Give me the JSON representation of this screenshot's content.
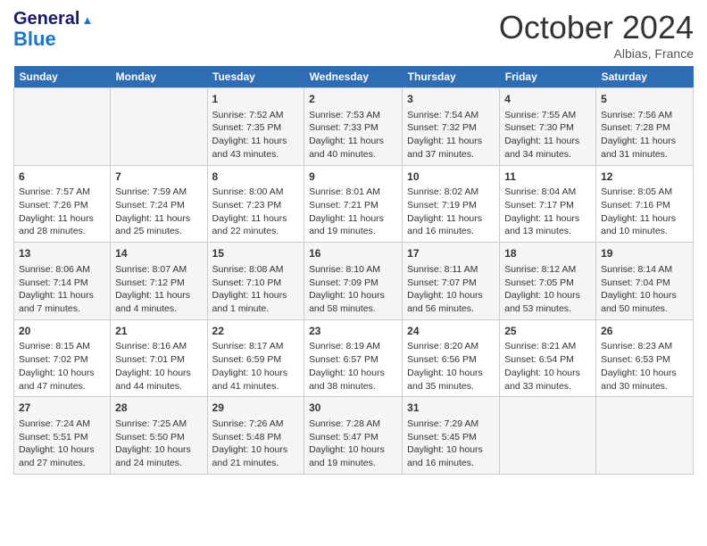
{
  "header": {
    "logo_line1": "General",
    "logo_line2": "Blue",
    "month": "October 2024",
    "location": "Albias, France"
  },
  "days_of_week": [
    "Sunday",
    "Monday",
    "Tuesday",
    "Wednesday",
    "Thursday",
    "Friday",
    "Saturday"
  ],
  "weeks": [
    [
      {
        "day": "",
        "sunrise": "",
        "sunset": "",
        "daylight": ""
      },
      {
        "day": "",
        "sunrise": "",
        "sunset": "",
        "daylight": ""
      },
      {
        "day": "1",
        "sunrise": "Sunrise: 7:52 AM",
        "sunset": "Sunset: 7:35 PM",
        "daylight": "Daylight: 11 hours and 43 minutes."
      },
      {
        "day": "2",
        "sunrise": "Sunrise: 7:53 AM",
        "sunset": "Sunset: 7:33 PM",
        "daylight": "Daylight: 11 hours and 40 minutes."
      },
      {
        "day": "3",
        "sunrise": "Sunrise: 7:54 AM",
        "sunset": "Sunset: 7:32 PM",
        "daylight": "Daylight: 11 hours and 37 minutes."
      },
      {
        "day": "4",
        "sunrise": "Sunrise: 7:55 AM",
        "sunset": "Sunset: 7:30 PM",
        "daylight": "Daylight: 11 hours and 34 minutes."
      },
      {
        "day": "5",
        "sunrise": "Sunrise: 7:56 AM",
        "sunset": "Sunset: 7:28 PM",
        "daylight": "Daylight: 11 hours and 31 minutes."
      }
    ],
    [
      {
        "day": "6",
        "sunrise": "Sunrise: 7:57 AM",
        "sunset": "Sunset: 7:26 PM",
        "daylight": "Daylight: 11 hours and 28 minutes."
      },
      {
        "day": "7",
        "sunrise": "Sunrise: 7:59 AM",
        "sunset": "Sunset: 7:24 PM",
        "daylight": "Daylight: 11 hours and 25 minutes."
      },
      {
        "day": "8",
        "sunrise": "Sunrise: 8:00 AM",
        "sunset": "Sunset: 7:23 PM",
        "daylight": "Daylight: 11 hours and 22 minutes."
      },
      {
        "day": "9",
        "sunrise": "Sunrise: 8:01 AM",
        "sunset": "Sunset: 7:21 PM",
        "daylight": "Daylight: 11 hours and 19 minutes."
      },
      {
        "day": "10",
        "sunrise": "Sunrise: 8:02 AM",
        "sunset": "Sunset: 7:19 PM",
        "daylight": "Daylight: 11 hours and 16 minutes."
      },
      {
        "day": "11",
        "sunrise": "Sunrise: 8:04 AM",
        "sunset": "Sunset: 7:17 PM",
        "daylight": "Daylight: 11 hours and 13 minutes."
      },
      {
        "day": "12",
        "sunrise": "Sunrise: 8:05 AM",
        "sunset": "Sunset: 7:16 PM",
        "daylight": "Daylight: 11 hours and 10 minutes."
      }
    ],
    [
      {
        "day": "13",
        "sunrise": "Sunrise: 8:06 AM",
        "sunset": "Sunset: 7:14 PM",
        "daylight": "Daylight: 11 hours and 7 minutes."
      },
      {
        "day": "14",
        "sunrise": "Sunrise: 8:07 AM",
        "sunset": "Sunset: 7:12 PM",
        "daylight": "Daylight: 11 hours and 4 minutes."
      },
      {
        "day": "15",
        "sunrise": "Sunrise: 8:08 AM",
        "sunset": "Sunset: 7:10 PM",
        "daylight": "Daylight: 11 hours and 1 minute."
      },
      {
        "day": "16",
        "sunrise": "Sunrise: 8:10 AM",
        "sunset": "Sunset: 7:09 PM",
        "daylight": "Daylight: 10 hours and 58 minutes."
      },
      {
        "day": "17",
        "sunrise": "Sunrise: 8:11 AM",
        "sunset": "Sunset: 7:07 PM",
        "daylight": "Daylight: 10 hours and 56 minutes."
      },
      {
        "day": "18",
        "sunrise": "Sunrise: 8:12 AM",
        "sunset": "Sunset: 7:05 PM",
        "daylight": "Daylight: 10 hours and 53 minutes."
      },
      {
        "day": "19",
        "sunrise": "Sunrise: 8:14 AM",
        "sunset": "Sunset: 7:04 PM",
        "daylight": "Daylight: 10 hours and 50 minutes."
      }
    ],
    [
      {
        "day": "20",
        "sunrise": "Sunrise: 8:15 AM",
        "sunset": "Sunset: 7:02 PM",
        "daylight": "Daylight: 10 hours and 47 minutes."
      },
      {
        "day": "21",
        "sunrise": "Sunrise: 8:16 AM",
        "sunset": "Sunset: 7:01 PM",
        "daylight": "Daylight: 10 hours and 44 minutes."
      },
      {
        "day": "22",
        "sunrise": "Sunrise: 8:17 AM",
        "sunset": "Sunset: 6:59 PM",
        "daylight": "Daylight: 10 hours and 41 minutes."
      },
      {
        "day": "23",
        "sunrise": "Sunrise: 8:19 AM",
        "sunset": "Sunset: 6:57 PM",
        "daylight": "Daylight: 10 hours and 38 minutes."
      },
      {
        "day": "24",
        "sunrise": "Sunrise: 8:20 AM",
        "sunset": "Sunset: 6:56 PM",
        "daylight": "Daylight: 10 hours and 35 minutes."
      },
      {
        "day": "25",
        "sunrise": "Sunrise: 8:21 AM",
        "sunset": "Sunset: 6:54 PM",
        "daylight": "Daylight: 10 hours and 33 minutes."
      },
      {
        "day": "26",
        "sunrise": "Sunrise: 8:23 AM",
        "sunset": "Sunset: 6:53 PM",
        "daylight": "Daylight: 10 hours and 30 minutes."
      }
    ],
    [
      {
        "day": "27",
        "sunrise": "Sunrise: 7:24 AM",
        "sunset": "Sunset: 5:51 PM",
        "daylight": "Daylight: 10 hours and 27 minutes."
      },
      {
        "day": "28",
        "sunrise": "Sunrise: 7:25 AM",
        "sunset": "Sunset: 5:50 PM",
        "daylight": "Daylight: 10 hours and 24 minutes."
      },
      {
        "day": "29",
        "sunrise": "Sunrise: 7:26 AM",
        "sunset": "Sunset: 5:48 PM",
        "daylight": "Daylight: 10 hours and 21 minutes."
      },
      {
        "day": "30",
        "sunrise": "Sunrise: 7:28 AM",
        "sunset": "Sunset: 5:47 PM",
        "daylight": "Daylight: 10 hours and 19 minutes."
      },
      {
        "day": "31",
        "sunrise": "Sunrise: 7:29 AM",
        "sunset": "Sunset: 5:45 PM",
        "daylight": "Daylight: 10 hours and 16 minutes."
      },
      {
        "day": "",
        "sunrise": "",
        "sunset": "",
        "daylight": ""
      },
      {
        "day": "",
        "sunrise": "",
        "sunset": "",
        "daylight": ""
      }
    ]
  ]
}
